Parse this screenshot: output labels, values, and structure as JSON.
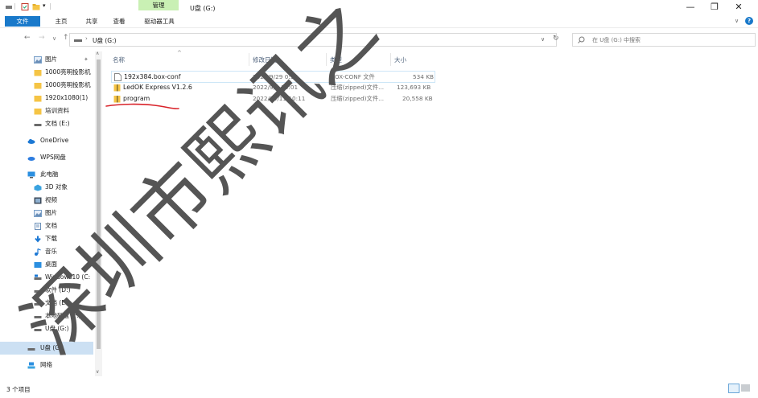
{
  "window": {
    "title": "U盘 (G:)",
    "manage_tab_label": "管理",
    "controls": {
      "minimize": "—",
      "restore": "❐",
      "close": "✕"
    }
  },
  "ribbon": {
    "tabs": [
      "文件",
      "主页",
      "共享",
      "查看",
      "驱动器工具"
    ],
    "help_label": "?"
  },
  "address": {
    "path": [
      "U盘 (G:)"
    ],
    "search_placeholder": "在 U盘 (G:) 中搜索"
  },
  "sidebar": {
    "items": [
      {
        "label": "图片",
        "icon": "pictures-icon",
        "pinned": true
      },
      {
        "label": "1000亮明投影机",
        "icon": "folder-icon",
        "pinned": true
      },
      {
        "label": "1000亮明投影机",
        "icon": "folder-icon"
      },
      {
        "label": "1920x1080(1)",
        "icon": "folder-icon"
      },
      {
        "label": "培训资料",
        "icon": "folder-icon"
      },
      {
        "label": "文档 (E:)",
        "icon": "drive-icon"
      },
      {
        "label": "OneDrive",
        "icon": "cloud-icon"
      },
      {
        "label": "WPS网盘",
        "icon": "wps-cloud-icon"
      },
      {
        "label": "此电脑",
        "icon": "pc-icon"
      },
      {
        "label": "3D 对象",
        "icon": "3d-objects-icon"
      },
      {
        "label": "视频",
        "icon": "video-icon"
      },
      {
        "label": "图片",
        "icon": "pictures-icon"
      },
      {
        "label": "文档",
        "icon": "documents-icon"
      },
      {
        "label": "下载",
        "icon": "download-icon"
      },
      {
        "label": "音乐",
        "icon": "music-icon"
      },
      {
        "label": "桌面",
        "icon": "desktop-icon"
      },
      {
        "label": "Windows10 (C:",
        "icon": "windows-drive-icon"
      },
      {
        "label": "软件 (D:)",
        "icon": "drive-icon"
      },
      {
        "label": "文档 (E:)",
        "icon": "drive-icon"
      },
      {
        "label": "本地磁盘 (F:)",
        "icon": "drive-icon"
      },
      {
        "label": "U盘 (G:)",
        "icon": "usb-drive-icon"
      },
      {
        "label": "U盘 (G:)",
        "icon": "usb-drive-icon",
        "selected": true
      },
      {
        "label": "网络",
        "icon": "network-icon"
      }
    ]
  },
  "filelist": {
    "columns": [
      "名称",
      "修改日期",
      "类型",
      "大小"
    ],
    "rows": [
      {
        "name": "192x384.box-conf",
        "date": "2022/9/29 0:38",
        "type": "BOX-CONF 文件",
        "size": "534 KB",
        "icon": "file-icon"
      },
      {
        "name": "LedOK Express V1.2.6",
        "date": "2022/9/9 15:01",
        "type": "压缩(zipped)文件...",
        "size": "123,693 KB",
        "icon": "zip-folder-icon"
      },
      {
        "name": "program",
        "date": "2022/10/11 10:11",
        "type": "压缩(zipped)文件...",
        "size": "20,558 KB",
        "icon": "zip-folder-icon"
      }
    ]
  },
  "status": {
    "count": "3 个项目"
  },
  "watermark_text": "深圳市熙讯之",
  "colors": {
    "accent": "#1979ca",
    "manage_tab": "#c9f0b4",
    "annotation": "#d9232a"
  }
}
